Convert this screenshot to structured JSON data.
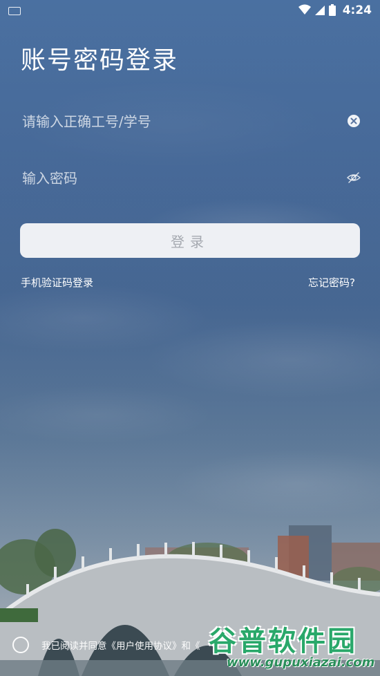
{
  "status_bar": {
    "time": "4:24"
  },
  "page": {
    "title": "账号密码登录"
  },
  "form": {
    "account_placeholder": "请输入正确工号/学号",
    "password_placeholder": "输入密码",
    "login_label": "登录",
    "sms_login_link": "手机验证码登录",
    "forgot_password_link": "忘记密码?"
  },
  "agreement": {
    "text": "我已阅读并同意《用户使用协议》和《"
  },
  "watermark": {
    "title": "谷普软件园",
    "url": "www.gupuxiazai.com"
  },
  "colors": {
    "button_bg": "#eef0f4",
    "button_text": "#a5a9b0",
    "watermark_green": "#29a86a"
  }
}
